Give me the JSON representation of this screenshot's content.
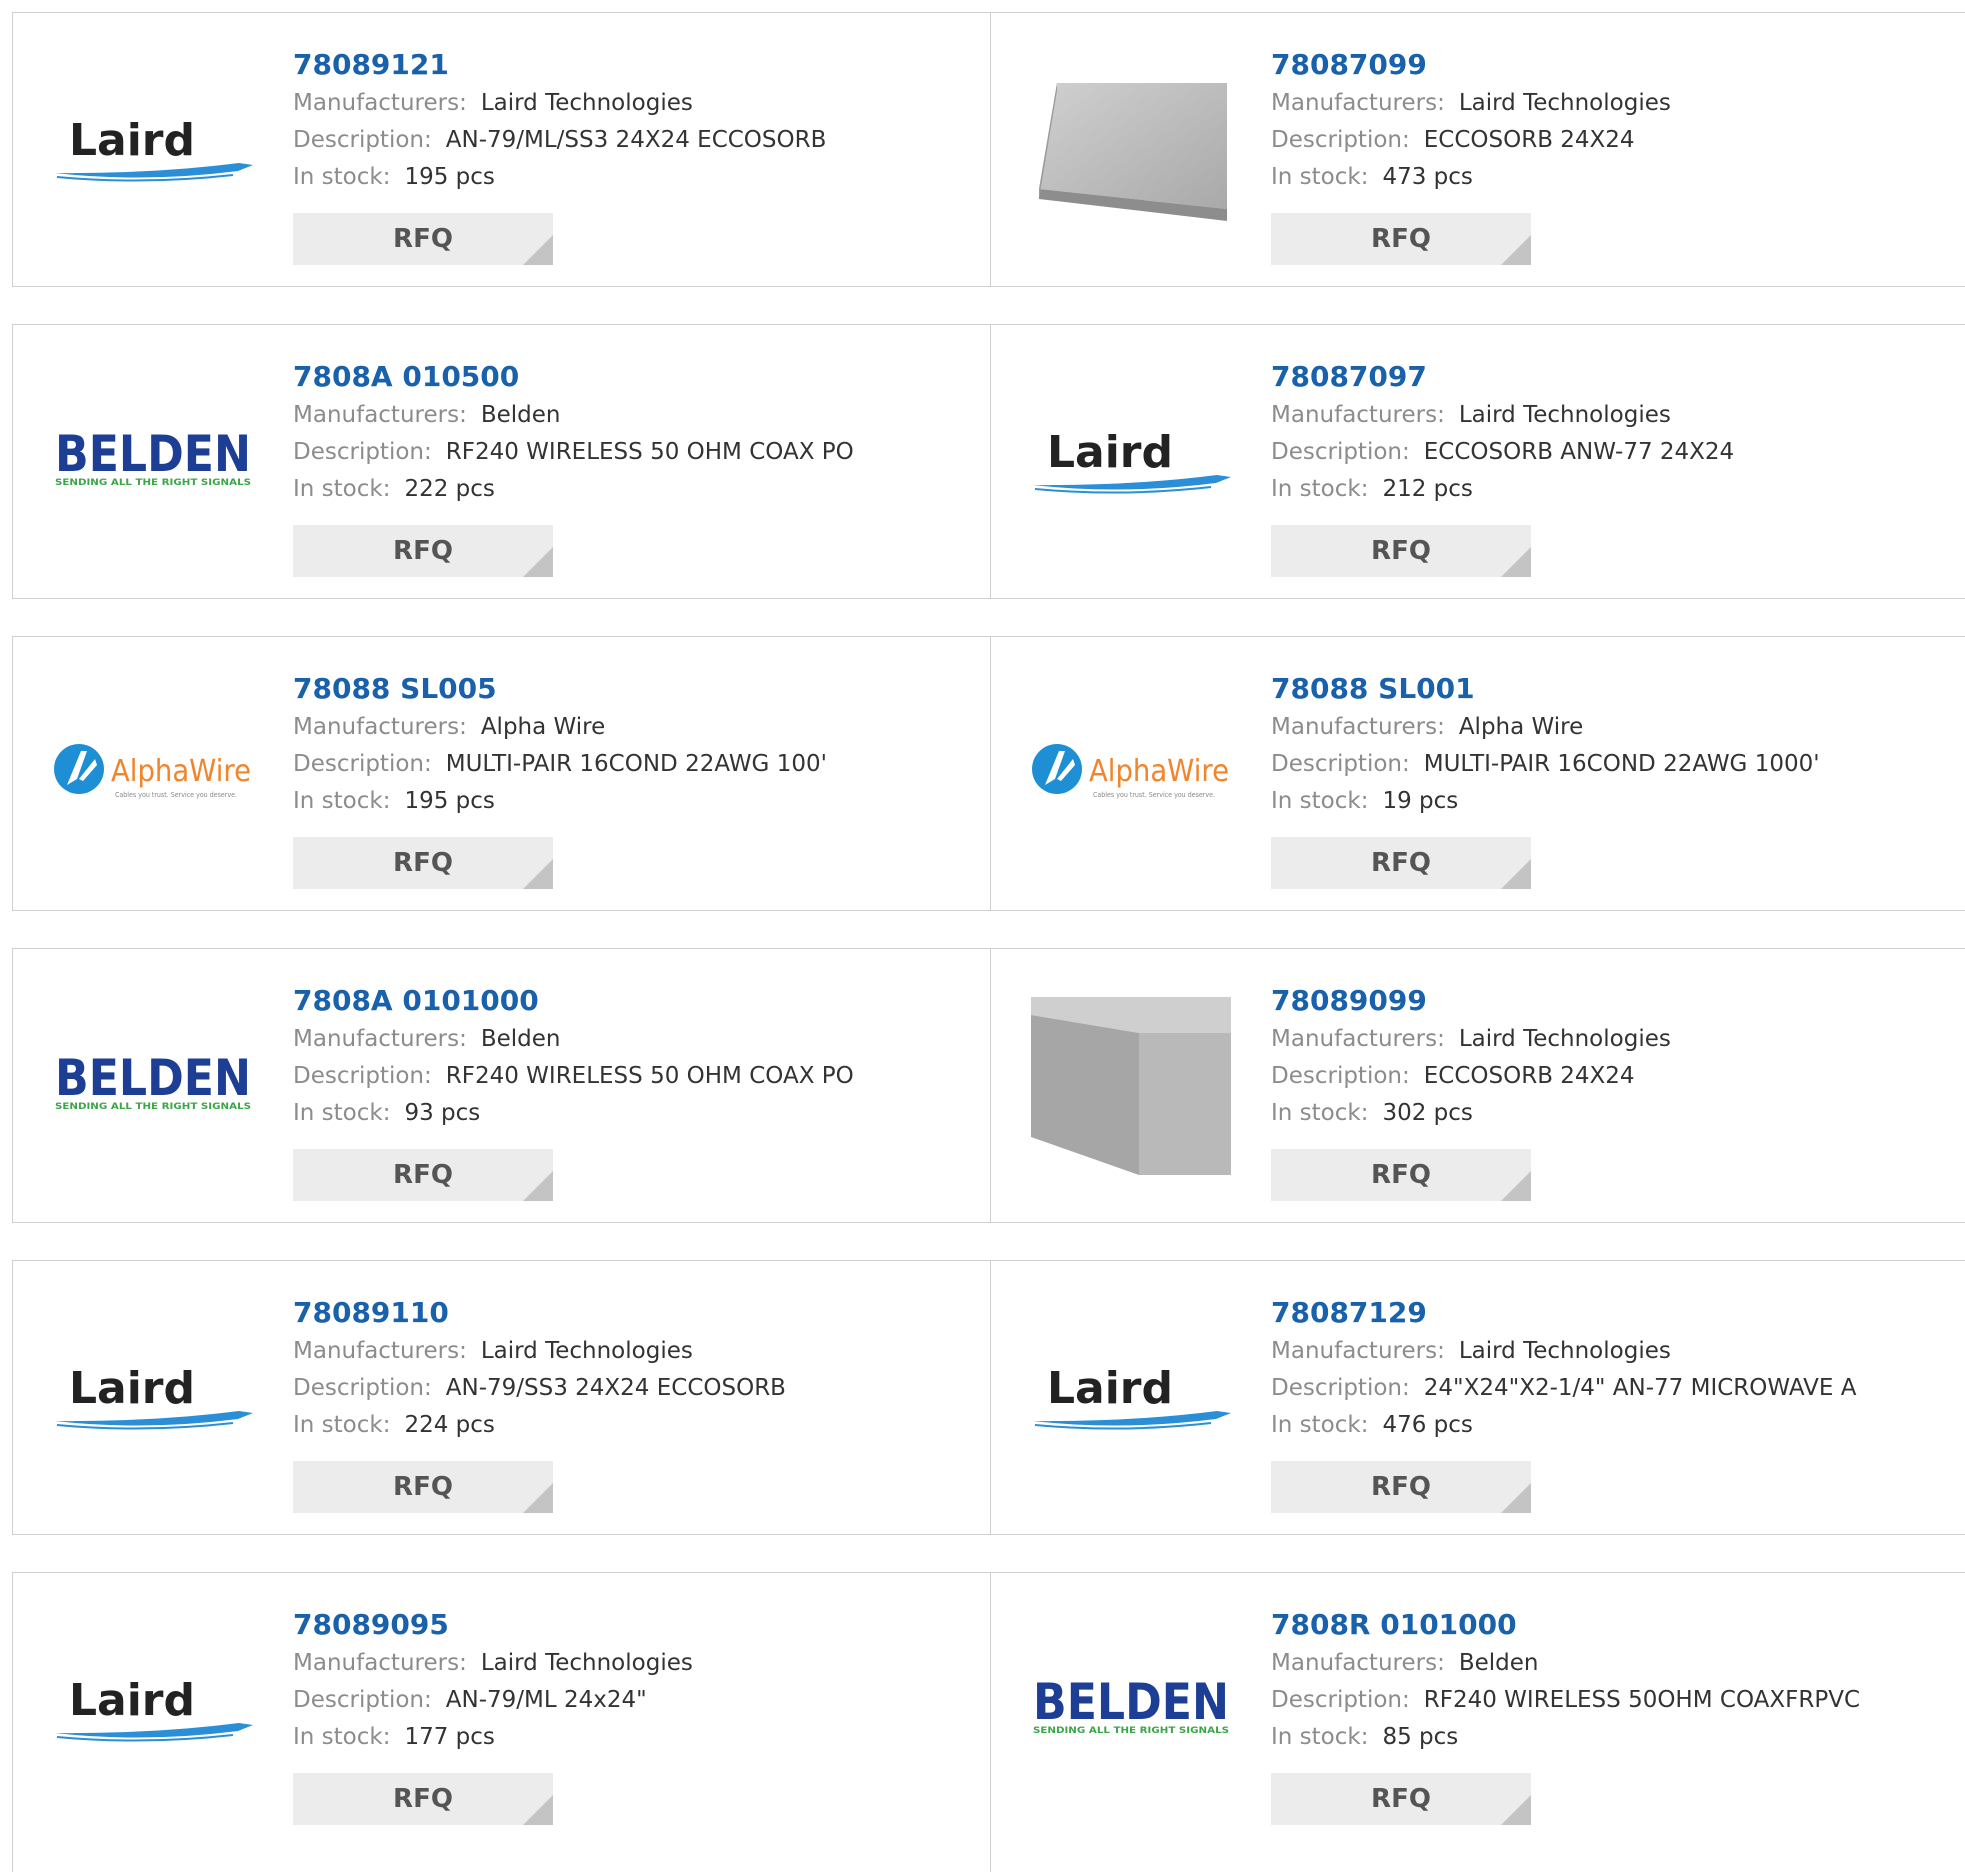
{
  "labels": {
    "manufacturers": "Manufacturers:",
    "description": "Description:",
    "in_stock": "In stock:",
    "rfq": "RFQ"
  },
  "logos": {
    "laird": "Laird",
    "belden": "BELDEN",
    "belden_tag": "SENDING ALL THE RIGHT SIGNALS",
    "alphawire": "AlphaWire",
    "alphawire_tag": "Cables you trust. Service you deserve."
  },
  "products": [
    {
      "pn": "78089121",
      "manufacturer": "Laird Technologies",
      "description": "AN-79/ML/SS3 24X24 ECCOSORB",
      "stock": "195 pcs",
      "logo": "laird"
    },
    {
      "pn": "78087099",
      "manufacturer": "Laird Technologies",
      "description": "ECCOSORB 24X24",
      "stock": "473 pcs",
      "logo": "foam-flat"
    },
    {
      "pn": "7808A 010500",
      "manufacturer": "Belden",
      "description": "RF240 WIRELESS 50 OHM COAX PO",
      "stock": "222 pcs",
      "logo": "belden"
    },
    {
      "pn": "78087097",
      "manufacturer": "Laird Technologies",
      "description": "ECCOSORB ANW-77 24X24",
      "stock": "212 pcs",
      "logo": "laird"
    },
    {
      "pn": "78088 SL005",
      "manufacturer": "Alpha Wire",
      "description": "MULTI-PAIR 16COND 22AWG 100'",
      "stock": "195 pcs",
      "logo": "alphawire"
    },
    {
      "pn": "78088 SL001",
      "manufacturer": "Alpha Wire",
      "description": "MULTI-PAIR 16COND 22AWG 1000'",
      "stock": "19 pcs",
      "logo": "alphawire"
    },
    {
      "pn": "7808A 0101000",
      "manufacturer": "Belden",
      "description": "RF240 WIRELESS 50 OHM COAX PO",
      "stock": "93 pcs",
      "logo": "belden"
    },
    {
      "pn": "78089099",
      "manufacturer": "Laird Technologies",
      "description": "ECCOSORB 24X24",
      "stock": "302 pcs",
      "logo": "foam-block"
    },
    {
      "pn": "78089110",
      "manufacturer": "Laird Technologies",
      "description": "AN-79/SS3 24X24 ECCOSORB",
      "stock": "224 pcs",
      "logo": "laird"
    },
    {
      "pn": "78087129",
      "manufacturer": "Laird Technologies",
      "description": "24\"X24\"X2-1/4\" AN-77 MICROWAVE A",
      "stock": "476 pcs",
      "logo": "laird"
    },
    {
      "pn": "78089095",
      "manufacturer": "Laird Technologies",
      "description": "AN-79/ML 24x24\"",
      "stock": "177 pcs",
      "logo": "laird"
    },
    {
      "pn": "7808R 0101000",
      "manufacturer": "Belden",
      "description": "RF240 WIRELESS 50OHM COAXFRPVC",
      "stock": "85 pcs",
      "logo": "belden"
    }
  ],
  "colors": {
    "part_number": "#1a61ac",
    "label": "#8c8c8c",
    "value": "#333333",
    "rfq_bg": "#ececec",
    "laird_blue": "#2a8fd6",
    "belden_blue": "#1c3f95",
    "belden_green": "#3aa648",
    "alpha_blue": "#1e8fd5",
    "alpha_orange": "#f0852d"
  }
}
